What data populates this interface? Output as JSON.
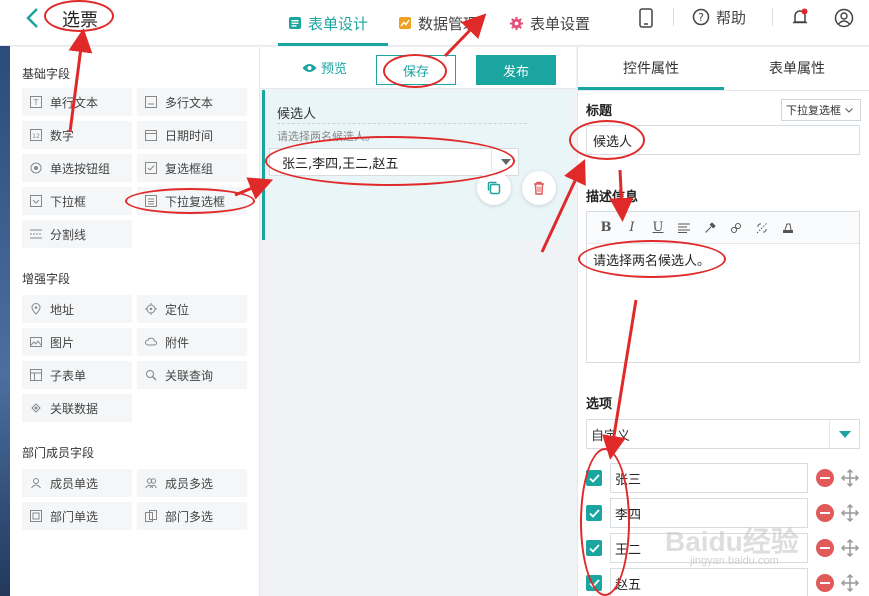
{
  "header": {
    "title": "选票",
    "nav": [
      {
        "label": "表单设计",
        "active": true
      },
      {
        "label": "数据管理",
        "active": false
      },
      {
        "label": "表单设置",
        "active": false
      }
    ],
    "help_label": "帮助"
  },
  "palette": {
    "groups": [
      {
        "title": "基础字段",
        "items": [
          "单行文本",
          "多行文本",
          "数字",
          "日期时间",
          "单选按钮组",
          "复选框组",
          "下拉框",
          "下拉复选框",
          "分割线"
        ]
      },
      {
        "title": "增强字段",
        "items": [
          "地址",
          "定位",
          "图片",
          "附件",
          "子表单",
          "关联查询",
          "关联数据"
        ]
      },
      {
        "title": "部门成员字段",
        "items": [
          "成员单选",
          "成员多选",
          "部门单选",
          "部门多选"
        ]
      }
    ]
  },
  "toolbar": {
    "preview_label": "预览",
    "save_label": "保存",
    "publish_label": "发布"
  },
  "canvas": {
    "field_label": "候选人",
    "field_desc": "请选择两名候选人。",
    "field_value": "张三,李四,王二,赵五"
  },
  "props": {
    "tabs": [
      "控件属性",
      "表单属性"
    ],
    "title_label": "标题",
    "control_type": "下拉复选框",
    "title_value": "候选人",
    "desc_label": "描述信息",
    "desc_value": "请选择两名候选人。",
    "editor_tools": [
      "B",
      "I",
      "U"
    ],
    "options_label": "选项",
    "options_source": "自定义",
    "options": [
      {
        "label": "张三",
        "checked": true
      },
      {
        "label": "李四",
        "checked": true
      },
      {
        "label": "王二",
        "checked": true
      },
      {
        "label": "赵五",
        "checked": true
      }
    ]
  },
  "watermark": {
    "text": "Baidu经验",
    "sub": "jingyan.baidu.com"
  },
  "colors": {
    "accent": "#1aa5a0",
    "annotation": "#e02a2a",
    "delete": "#e05a5a"
  }
}
